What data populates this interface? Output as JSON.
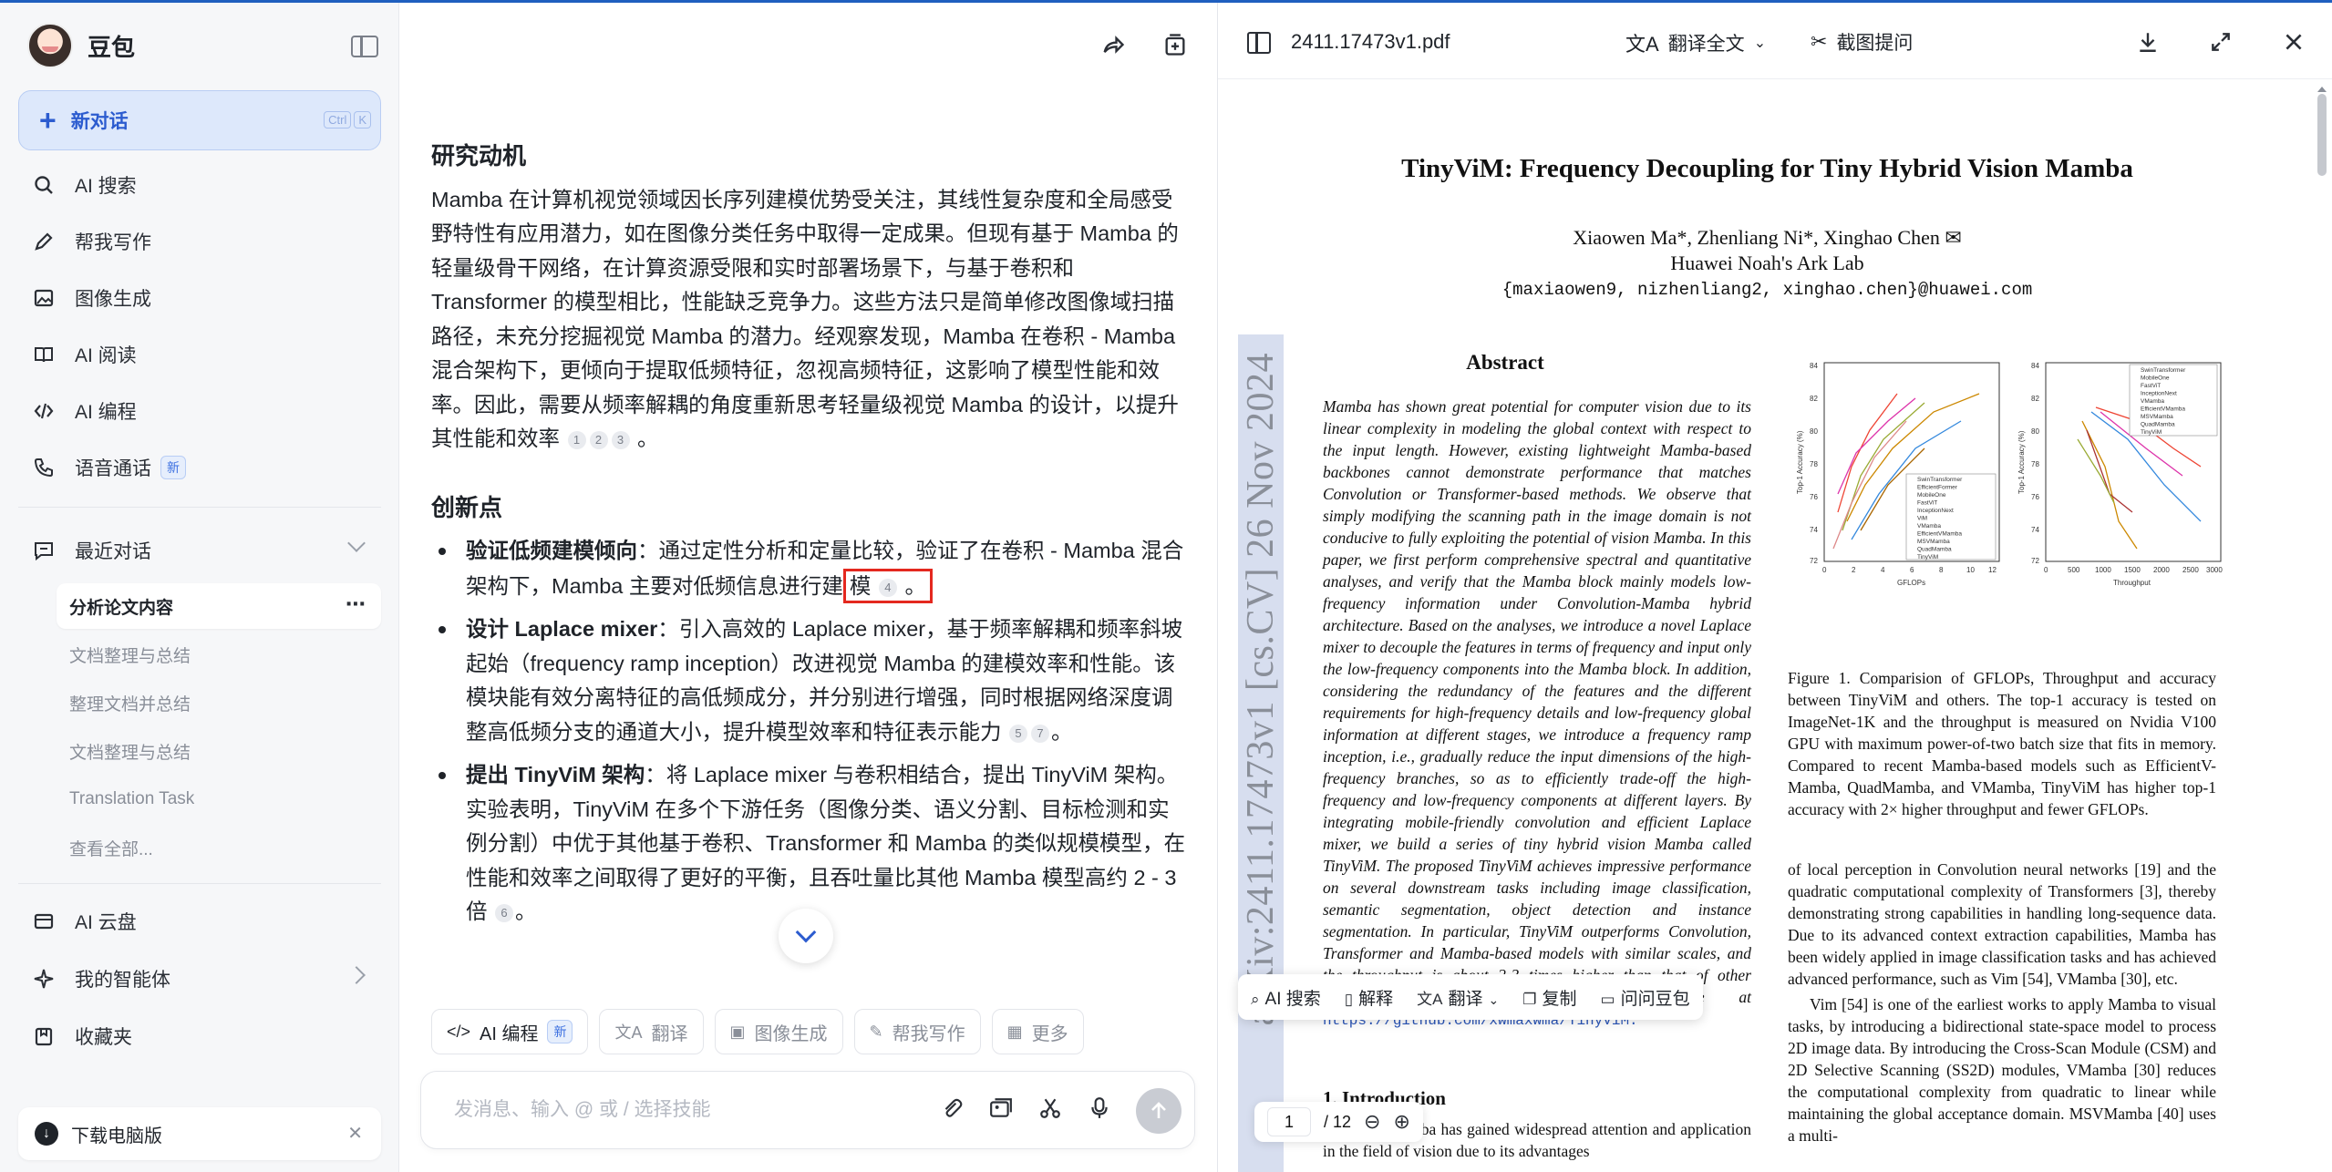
{
  "sidebar": {
    "brand": "豆包",
    "new_chat": "新对话",
    "shortcut": [
      "Ctrl",
      "K"
    ],
    "nav": [
      {
        "label": "AI 搜索",
        "icon": "search-icon"
      },
      {
        "label": "帮我写作",
        "icon": "pen-icon"
      },
      {
        "label": "图像生成",
        "icon": "image-icon"
      },
      {
        "label": "AI 阅读",
        "icon": "book-icon"
      },
      {
        "label": "AI 编程",
        "icon": "code-icon"
      },
      {
        "label": "语音通话",
        "icon": "phone-icon",
        "badge": "新"
      }
    ],
    "recent_label": "最近对话",
    "recent_items": [
      "分析论文内容",
      "文档整理与总结",
      "整理文档并总结",
      "文档整理与总结",
      "Translation Task",
      "查看全部..."
    ],
    "cloud": "AI 云盘",
    "agents": "我的智能体",
    "favorites": "收藏夹",
    "download": "下载电脑版"
  },
  "chat": {
    "section1_title": "研究动机",
    "section1_body": "Mamba 在计算机视觉领域因长序列建模优势受关注，其线性复杂度和全局感受野特性有应用潜力，如在图像分类任务中取得一定成果。但现有基于 Mamba 的轻量级骨干网络，在计算资源受限和实时部署场景下，与基于卷积和 Transformer 的模型相比，性能缺乏竞争力。这些方法只是简单修改图像域扫描路径，未充分挖掘视觉 Mamba 的潜力。经观察发现，Mamba 在卷积 - Mamba 混合架构下，更倾向于提取低频特征，忽视高频特征，这影响了模型性能和效率。因此，需要从频率解耦的角度重新思考轻量级视觉 Mamba 的设计，以提升其性能和效率",
    "section1_cites": [
      "1",
      "2",
      "3"
    ],
    "section2_title": "创新点",
    "points": [
      {
        "bold": "验证低频建模倾向",
        "text_before": "：通过定性分析和定量比较，验证了在卷积 - Mamba 混合架构下，Mamba 主要对低频信息进行建",
        "highlight": "模",
        "cites": [
          "4"
        ],
        "end": "。"
      },
      {
        "bold": "设计 Laplace mixer",
        "text_before": "：引入高效的 Laplace mixer，基于频率解耦和频率斜坡起始（frequency ramp inception）改进视觉 Mamba 的建模效率和性能。该模块能有效分离特征的高低频成分，并分别进行增强，同时根据网络深度调整高低频分支的通道大小，提升模型效率和特征表示能力",
        "highlight": "",
        "cites": [
          "5",
          "7"
        ],
        "end": "。"
      },
      {
        "bold": "提出 TinyViM 架构",
        "text_before": "：将 Laplace mixer 与卷积相结合，提出 TinyViM 架构。实验表明，TinyViM 在多个下游任务（图像分类、语义分割、目标检测和实例分割）中优于其他基于卷积、Transformer 和 Mamba 的类似规模模型，在性能和效率之间取得了更好的平衡，且吞吐量比其他 Mamba 模型高约 2 - 3 倍",
        "highlight": "",
        "cites": [
          "6"
        ],
        "end": "。"
      }
    ],
    "skills": [
      {
        "label": "AI 编程",
        "badge": "新",
        "icon": "code-icon"
      },
      {
        "label": "翻译",
        "icon": "translate-icon"
      },
      {
        "label": "图像生成",
        "icon": "image-icon"
      },
      {
        "label": "帮我写作",
        "icon": "pen-icon"
      },
      {
        "label": "更多",
        "icon": "grid-icon"
      }
    ],
    "input_placeholder": "发消息、输入 @ 或 / 选择技能"
  },
  "viewer": {
    "filename": "2411.17473v1.pdf",
    "translate_all": "翻译全文",
    "screenshot_ask": "截图提问",
    "page_current": "1",
    "page_total": "/ 12",
    "selection_toolbar": [
      "AI 搜索",
      "解释",
      "翻译",
      "复制",
      "问问豆包"
    ],
    "paper": {
      "arxiv_stamp": "arXiv:2411.17473v1  [cs.CV]  26 Nov 2024",
      "title": "TinyViM: Frequency Decoupling for Tiny Hybrid Vision Mamba",
      "authors": "Xiaowen Ma*,    Zhenliang Ni*,    Xinghao Chen ✉",
      "affiliation": "Huawei Noah's Ark Lab",
      "emails": "{maxiaowen9, nizhenliang2, xinghao.chen}@huawei.com",
      "abstract_title": "Abstract",
      "abstract": "Mamba has shown great potential for computer vision due to its linear complexity in modeling the global context with respect to the input length. However, existing lightweight Mamba-based backbones cannot demonstrate performance that matches Convolution or Transformer-based methods. We observe that simply modifying the scanning path in the image domain is not conducive to fully exploiting the potential of vision Mamba. In this paper, we first perform comprehensive spectral and quantitative analyses, and verify that the Mamba block mainly models low-frequency information under Convolution-Mamba hybrid architecture. Based on the analyses, we introduce a novel Laplace mixer to decouple the features in terms of frequency and input only the low-frequency components into the Mamba block. In addition, considering the redundancy of the features and the different requirements for high-frequency details and low-frequency global information at different stages, we introduce a frequency ramp inception, i.e., gradually reduce the input dimensions of the high-frequency branches, so as to efficiently trade-off the high-frequency and low-frequency components at different layers. By integrating mobile-friendly convolution and efficient Laplace mixer, we build a series of tiny hybrid vision Mamba called TinyViM. The proposed TinyViM achieves impressive performance on several downstream tasks including image classification, semantic segmentation, object detection and instance segmentation. In particular, TinyViM outperforms Convolution, Transformer and Mamba-based models with similar scales, and the throughput is about 2-3 times higher than that of other Mamba-based models. Code is available at",
      "code_link": "https://github.com/xwmaxwma/TinyViM.",
      "intro_heading": "1. Introduction",
      "intro": "Recently, Mamba has gained widespread attention and application in the field of vision due to its advantages",
      "figure_caption": "Figure 1.  Comparision of GFLOPs, Throughput and accuracy between TinyViM and others.  The top-1 accuracy is tested on ImageNet-1K and the throughput is measured on Nvidia V100 GPU with maximum power-of-two batch size that fits in memory. Compared to recent Mamba-based models such as EfficientV-Mamba, QuadMamba, and VMamba, TinyViM has higher top-1 accuracy with 2× higher throughput and fewer GFLOPs.",
      "right_body_1": "of local perception in Convolution neural networks [19] and the quadratic computational complexity of Transformers [3], thereby demonstrating strong capabilities in handling long-sequence data. Due to its advanced context extraction capabilities, Mamba has been widely applied in image classification tasks and has achieved advanced performance, such as Vim [54], VMamba [30], etc.",
      "right_body_2": "Vim [54] is one of the earliest works to apply Mamba to visual tasks, by introducing a bidirectional state-space model to process 2D image data.  By introducing the Cross-Scan Module (CSM) and 2D Selective Scanning (SS2D) modules, VMamba [30] reduces the computational complexity from quadratic to linear while maintaining the global acceptance domain. MSVMamba [40] uses a multi-",
      "chart1": {
        "xlabel": "GFLOPs",
        "ylabel": "Top-1 Accuracy (%)",
        "xticks": [
          "0",
          "2",
          "4",
          "6",
          "8",
          "10",
          "12"
        ],
        "yticks": [
          "72",
          "74",
          "76",
          "78",
          "80",
          "82",
          "84"
        ]
      },
      "chart2": {
        "xlabel": "Throughput",
        "ylabel": "Top-1 Accuracy (%)",
        "xticks": [
          "0",
          "500",
          "1000",
          "1500",
          "2000",
          "2500",
          "3000"
        ],
        "yticks": [
          "72",
          "74",
          "76",
          "78",
          "80",
          "82",
          "84"
        ]
      },
      "legend1": [
        "SwinTransformer",
        "EfficientFormer",
        "MobileOne",
        "FastViT",
        "InceptionNext",
        "ViM",
        "VMamba",
        "EfficientVMamba",
        "MSVMamba",
        "QuadMamba",
        "TinyViM"
      ],
      "legend2": [
        "SwinTransformer",
        "MobileOne",
        "FastViT",
        "InceptionNext",
        "VMamba",
        "EfficientVMamba",
        "MSVMamba",
        "QuadMamba",
        "TinyViM"
      ]
    }
  },
  "colors": {
    "accent": "#2c5ccf",
    "highlight_box": "#e4281f",
    "link": "#2a55b8"
  }
}
